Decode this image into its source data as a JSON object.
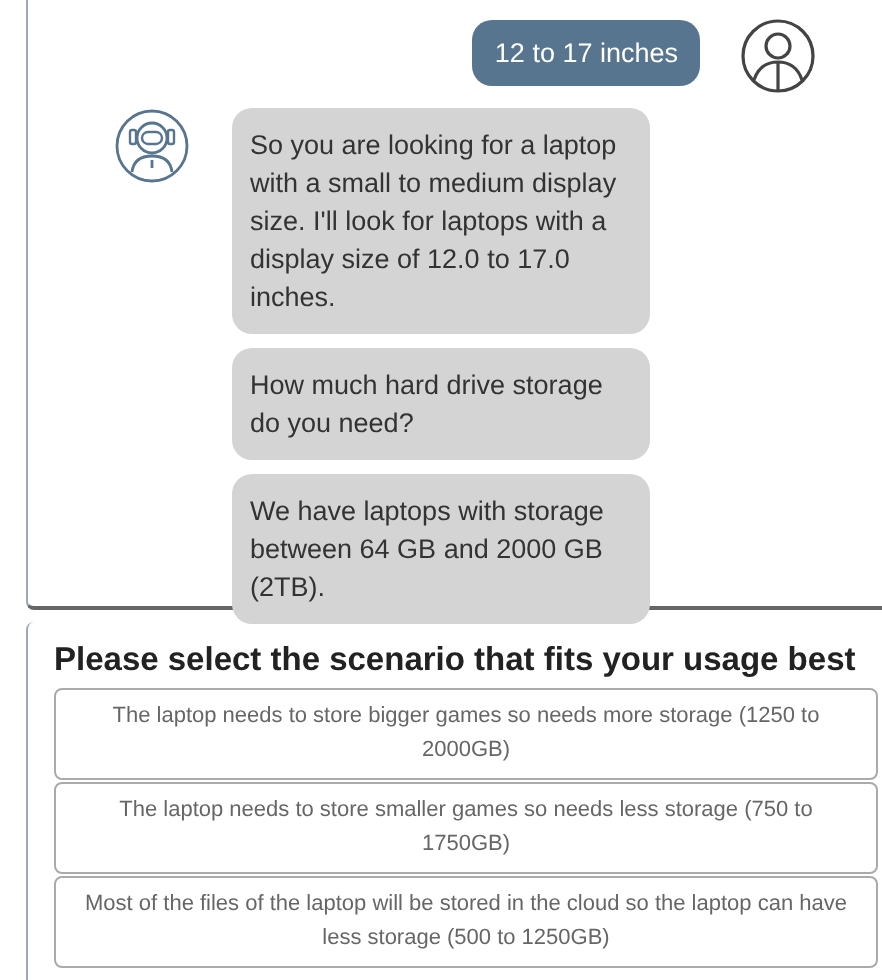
{
  "messages": [
    {
      "kind": "user",
      "text": "12 to 17 inches",
      "show_avatar": true
    },
    {
      "kind": "bot",
      "text": "So you are looking for a laptop with a small to medium display size. I'll look for laptops with a display size of 12.0 to 17.0 inches.",
      "show_avatar": true
    },
    {
      "kind": "bot",
      "text": "How much hard drive storage do you need?",
      "show_avatar": false
    },
    {
      "kind": "bot",
      "text": "We have laptops with storage between 64 GB and 2000 GB (2TB).",
      "show_avatar": false
    }
  ],
  "prompt": {
    "title": "Please select the scenario that fits your usage best",
    "options": [
      {
        "label": "The laptop needs to store bigger games so needs more storage (1250 to 2000GB)"
      },
      {
        "label": "The laptop needs to store smaller games so needs less storage (750 to 1750GB)"
      },
      {
        "label": "Most of the files of the laptop will be stored in the cloud so the laptop can have less storage (500 to 1250GB)"
      }
    ]
  }
}
